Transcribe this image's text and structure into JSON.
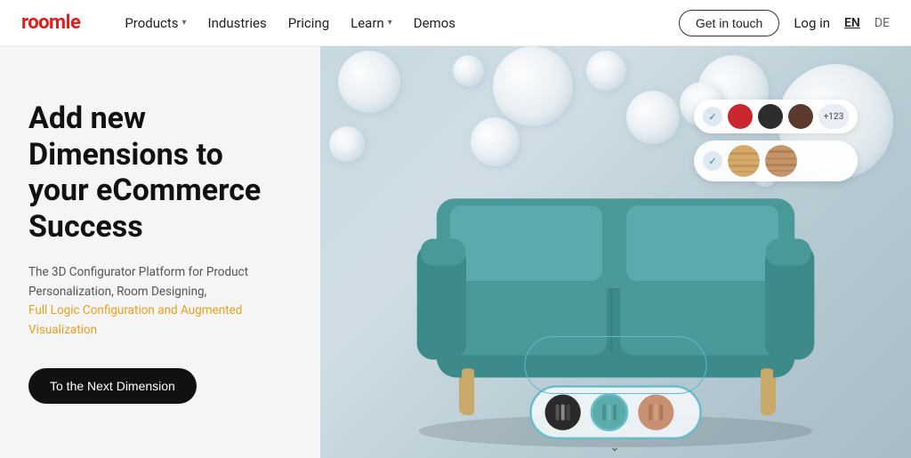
{
  "brand": {
    "name": "roomle",
    "color": "#e31c1c"
  },
  "nav": {
    "items": [
      {
        "label": "Products",
        "hasDropdown": true
      },
      {
        "label": "Industries",
        "hasDropdown": false
      },
      {
        "label": "Pricing",
        "hasDropdown": false
      },
      {
        "label": "Learn",
        "hasDropdown": true
      },
      {
        "label": "Demos",
        "hasDropdown": false
      }
    ],
    "cta": "Get in touch",
    "login": "Log in",
    "lang_en": "EN",
    "lang_de": "DE"
  },
  "hero": {
    "title": "Add new Dimensions to your eCommerce Success",
    "subtitle_line1": "The 3D Configurator Platform for Product",
    "subtitle_line2": "Personalization, Room Designing,",
    "subtitle_line3_highlight": "Full Logic Configuration and Augmented Visualization",
    "cta_button": "To the Next Dimension"
  },
  "color_picker": {
    "row1": {
      "colors": [
        "#c8282e",
        "#333333",
        "#5c3a2e"
      ],
      "more": "+123"
    },
    "row2": {
      "materials": [
        "wood_light",
        "wood_medium"
      ]
    }
  }
}
